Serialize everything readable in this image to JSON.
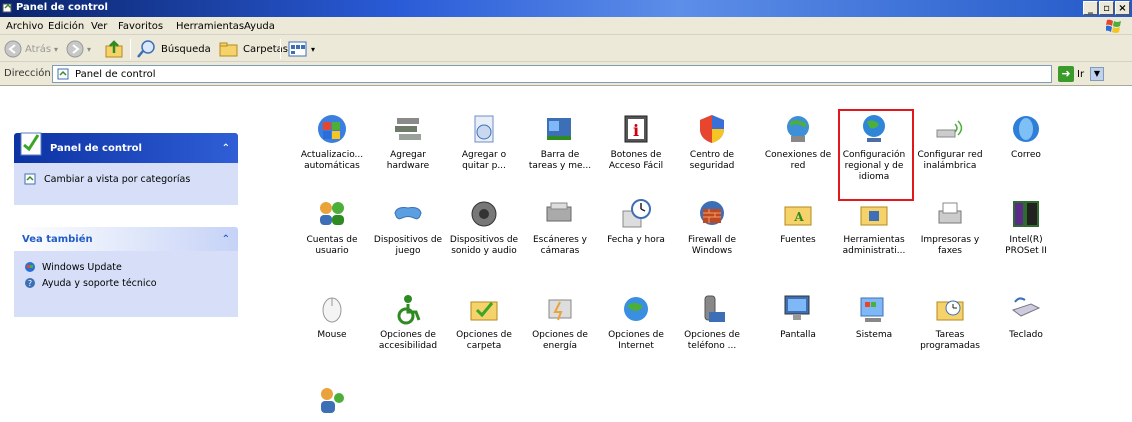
{
  "window": {
    "title": "Panel de control"
  },
  "window_buttons": [
    "_",
    "̵",
    "X"
  ],
  "menu": [
    "Archivo",
    "Edición",
    "Ver",
    "Favoritos",
    "Herramientas",
    "Ayuda"
  ],
  "toolbar": {
    "back": "Atrás",
    "search": "Búsqueda",
    "folders": "Carpetas"
  },
  "address": {
    "label": "Dirección",
    "value": "Panel de control",
    "go": "Ir"
  },
  "left_panels": {
    "control_panel": {
      "title": "Panel de control",
      "link": "Cambiar a vista por categorías"
    },
    "see_also": {
      "title": "Vea también",
      "links": [
        "Windows Update",
        "Ayuda y soporte técnico"
      ]
    }
  },
  "items": [
    {
      "label": "Actualizacio...\nautomáticas",
      "icon": "windows-update-icon"
    },
    {
      "label": "Agregar\nhardware",
      "icon": "add-hardware-icon"
    },
    {
      "label": "Agregar o\nquitar p...",
      "icon": "add-remove-programs-icon"
    },
    {
      "label": "Barra de\ntareas y me...",
      "icon": "taskbar-start-menu-icon"
    },
    {
      "label": "Botones de\nAcceso Fácil",
      "icon": "accessibility-buttons-icon"
    },
    {
      "label": "Centro de\nseguridad",
      "icon": "security-center-icon"
    },
    {
      "label": "Conexiones de\nred",
      "icon": "network-connections-icon"
    },
    {
      "label": "Configuración\nregional y de\nidioma",
      "icon": "regional-language-icon"
    },
    {
      "label": "Configurar red\ninalámbrica",
      "icon": "wireless-network-icon"
    },
    {
      "label": "Correo",
      "icon": "mail-icon"
    },
    {
      "label": "Cuentas de\nusuario",
      "icon": "user-accounts-icon"
    },
    {
      "label": "Dispositivos de\njuego",
      "icon": "game-controllers-icon"
    },
    {
      "label": "Dispositivos de\nsonido y audio",
      "icon": "sound-audio-icon"
    },
    {
      "label": "Escáneres y\ncámaras",
      "icon": "scanners-cameras-icon"
    },
    {
      "label": "Fecha y hora",
      "icon": "date-time-icon"
    },
    {
      "label": "Firewall de\nWindows",
      "icon": "firewall-icon"
    },
    {
      "label": "Fuentes",
      "icon": "fonts-folder-icon"
    },
    {
      "label": "Herramientas\nadministrati...",
      "icon": "admin-tools-icon"
    },
    {
      "label": "Impresoras y\nfaxes",
      "icon": "printers-faxes-icon"
    },
    {
      "label": "Intel(R)\nPROSet II",
      "icon": "intel-proset-icon"
    },
    {
      "label": "Mouse",
      "icon": "mouse-icon"
    },
    {
      "label": "Opciones de\naccesibilidad",
      "icon": "accessibility-options-icon"
    },
    {
      "label": "Opciones de\ncarpeta",
      "icon": "folder-options-icon"
    },
    {
      "label": "Opciones de\nenergía",
      "icon": "power-options-icon"
    },
    {
      "label": "Opciones de\nInternet",
      "icon": "internet-options-icon"
    },
    {
      "label": "Opciones de\nteléfono ...",
      "icon": "phone-modem-icon"
    },
    {
      "label": "Pantalla",
      "icon": "display-icon"
    },
    {
      "label": "Sistema",
      "icon": "system-icon"
    },
    {
      "label": "Tareas\nprogramadas",
      "icon": "scheduled-tasks-icon"
    },
    {
      "label": "Teclado",
      "icon": "keyboard-icon"
    },
    {
      "label": "",
      "icon": "user-accounts-2-icon"
    }
  ],
  "selected_item": "Configuración\nregional y de\nidioma",
  "colors": {
    "highlight_border": "#e0181e",
    "title_gradient": "#0a246a",
    "panel_bg": "#d6dff7"
  }
}
